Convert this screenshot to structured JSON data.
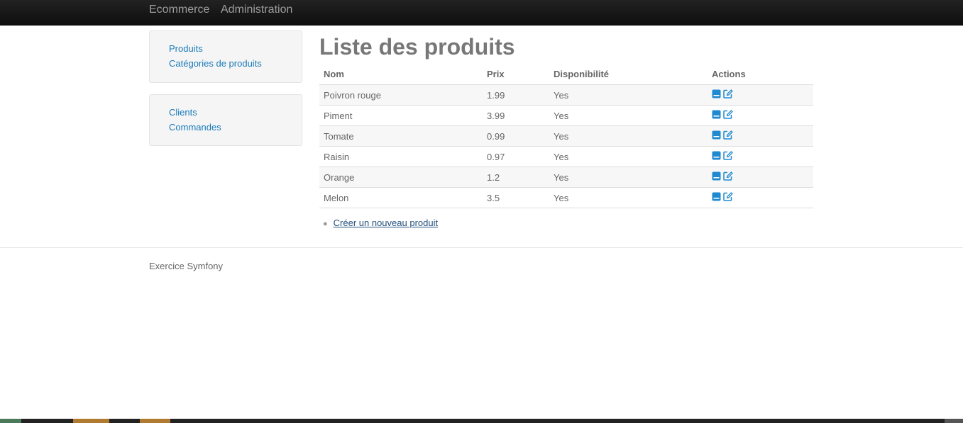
{
  "navbar": {
    "brand": "Ecommerce",
    "administration": "Administration"
  },
  "sidebar": {
    "group1": [
      {
        "label": "Produits"
      },
      {
        "label": "Catégories de produits"
      }
    ],
    "group2": [
      {
        "label": "Clients"
      },
      {
        "label": "Commandes"
      }
    ]
  },
  "main": {
    "title": "Liste des produits",
    "table": {
      "headers": [
        "Nom",
        "Prix",
        "Disponibilité",
        "Actions"
      ],
      "rows": [
        {
          "nom": "Poivron rouge",
          "prix": "1.99",
          "dispo": "Yes"
        },
        {
          "nom": "Piment",
          "prix": "3.99",
          "dispo": "Yes"
        },
        {
          "nom": "Tomate",
          "prix": "0.99",
          "dispo": "Yes"
        },
        {
          "nom": "Raisin",
          "prix": "0.97",
          "dispo": "Yes"
        },
        {
          "nom": "Orange",
          "prix": "1.2",
          "dispo": "Yes"
        },
        {
          "nom": "Melon",
          "prix": "3.5",
          "dispo": "Yes"
        }
      ],
      "action_icons": [
        "show-icon",
        "edit-icon"
      ]
    },
    "create_link": "Créer un nouveau produit"
  },
  "footer": {
    "text": "Exercice Symfony"
  },
  "colors": {
    "navbar": "#1b1b1b",
    "link": "#1a7ab8",
    "icon": "#1f8ad0",
    "title": "#777777"
  }
}
